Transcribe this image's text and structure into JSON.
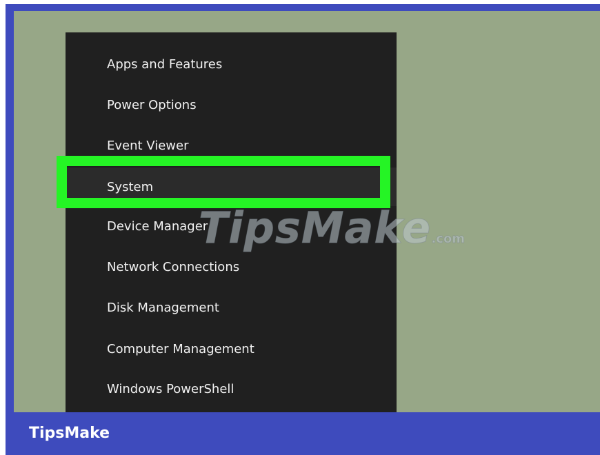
{
  "menu": {
    "items": [
      {
        "label": "Apps and Features"
      },
      {
        "label": "Power Options"
      },
      {
        "label": "Event Viewer"
      },
      {
        "label": "System",
        "selected": true
      },
      {
        "label": "Device Manager"
      },
      {
        "label": "Network Connections"
      },
      {
        "label": "Disk Management"
      },
      {
        "label": "Computer Management"
      },
      {
        "label": "Windows PowerShell"
      }
    ]
  },
  "watermark": {
    "text": "TipsMake",
    "tld": ".com"
  },
  "footer": {
    "brand": "TipsMake"
  },
  "colors": {
    "frame": "#3e4bbd",
    "desktop": "#97a787",
    "menu_background": "#202020",
    "highlight": "#25f425",
    "menu_text": "#f2f2f2"
  }
}
